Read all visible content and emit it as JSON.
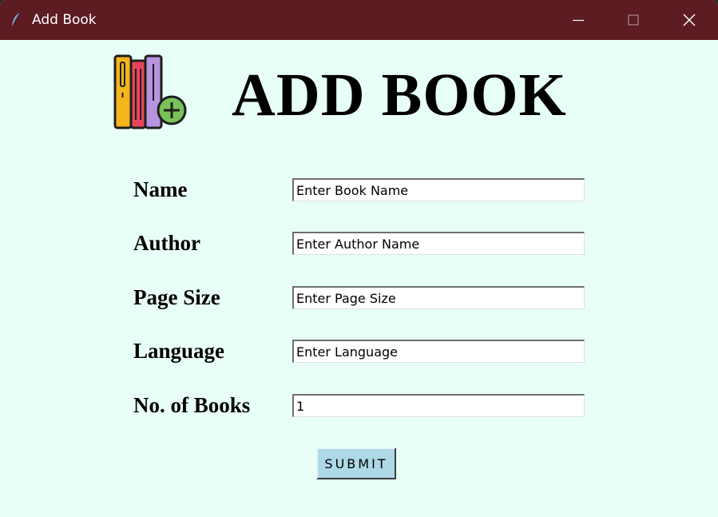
{
  "window": {
    "title": "Add Book",
    "controls": [
      "minimize-icon",
      "maximize-icon",
      "close-icon"
    ],
    "titlebar_color": "#5c1c22",
    "background_color": "#e8fff8"
  },
  "header": {
    "logo_icon": "books-add-icon",
    "title": "ADD BOOK"
  },
  "form": {
    "fields": [
      {
        "label": "Name",
        "value": "Enter Book Name"
      },
      {
        "label": "Author",
        "value": "Enter Author Name"
      },
      {
        "label": "Page Size",
        "value": "Enter Page Size"
      },
      {
        "label": "Language",
        "value": "Enter Language"
      },
      {
        "label": "No. of Books",
        "value": "1"
      }
    ],
    "submit_label": "SUBMIT",
    "submit_color": "#add8e6"
  }
}
